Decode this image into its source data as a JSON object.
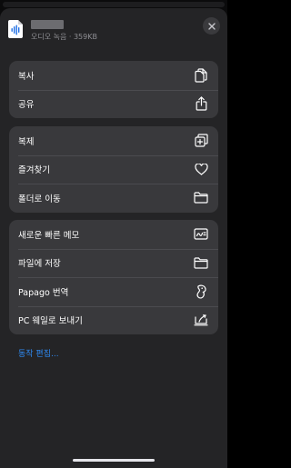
{
  "header": {
    "file_meta": "오디오 녹음 · 359KB",
    "file_icon": "audio-file-icon",
    "close_icon": "close-icon"
  },
  "groups": [
    {
      "items": [
        {
          "label": "복사",
          "icon": "copy-icon"
        },
        {
          "label": "공유",
          "icon": "share-icon"
        }
      ]
    },
    {
      "items": [
        {
          "label": "복제",
          "icon": "duplicate-icon"
        },
        {
          "label": "즐겨찾기",
          "icon": "heart-icon"
        },
        {
          "label": "폴더로 이동",
          "icon": "folder-icon"
        }
      ]
    },
    {
      "items": [
        {
          "label": "새로운 빠른 메모",
          "icon": "quick-note-icon"
        },
        {
          "label": "파일에 저장",
          "icon": "folder-icon"
        },
        {
          "label": "Papago 번역",
          "icon": "papago-icon"
        },
        {
          "label": "PC 웨일로 보내기",
          "icon": "whale-pc-icon"
        }
      ]
    }
  ],
  "edit_actions_label": "동작 편집...",
  "colors": {
    "sheet": "#242426",
    "group": "#39393c",
    "accent": "#2f8bf5"
  }
}
